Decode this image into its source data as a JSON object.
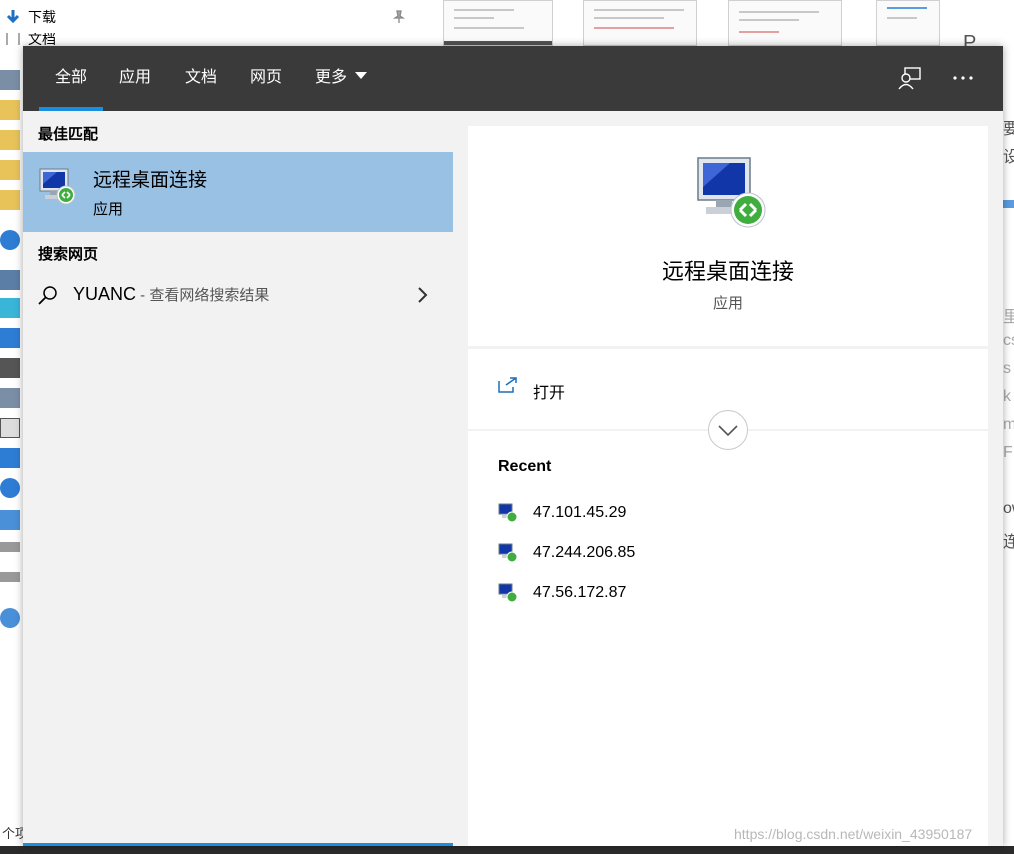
{
  "background": {
    "nav_items": [
      "下载",
      "文档"
    ],
    "side_label": "个项",
    "right_fragments": [
      "要",
      "设",
      "P",
      "里",
      "cs",
      "s",
      "k",
      "m",
      "F",
      "ow",
      "连"
    ]
  },
  "search": {
    "tabs": [
      "全部",
      "应用",
      "文档",
      "网页",
      "更多"
    ],
    "active_tab": "全部",
    "best_match_header": "最佳匹配",
    "best_match": {
      "name": "远程桌面连接",
      "type": "应用"
    },
    "web_header": "搜索网页",
    "web_query": "YUANC",
    "web_hint": " - 查看网络搜索结果"
  },
  "detail": {
    "title": "远程桌面连接",
    "subtitle": "应用",
    "open_label": "打开",
    "recent_header": "Recent",
    "recent_items": [
      "47.101.45.29",
      "47.244.206.85",
      "47.56.172.87"
    ]
  },
  "colors": {
    "topbar": "#3a3a3a",
    "accent": "#1a8fdf",
    "selected": "#98c1e4",
    "panel_bg": "#f2f2f2"
  },
  "watermark": "https://blog.csdn.net/weixin_43950187"
}
